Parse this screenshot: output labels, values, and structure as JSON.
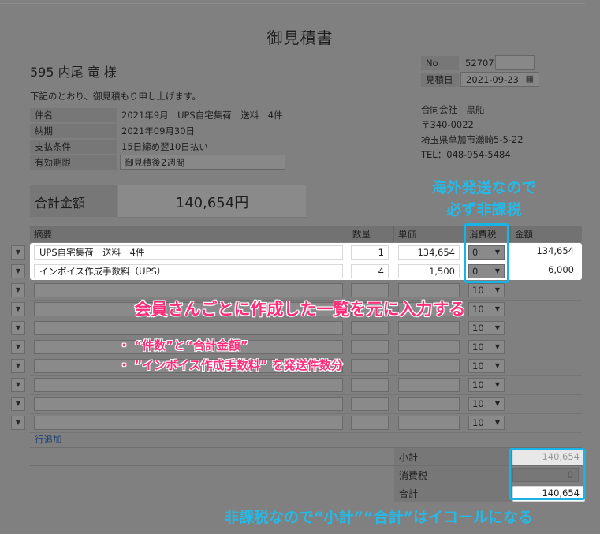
{
  "title": "御見積書",
  "customer": "595 内尾 竜 様",
  "intro": "下記のとおり、御見積もり申し上げます。",
  "info": [
    {
      "label": "件名",
      "value": "2021年9月　UPS自宅集荷　送料　4件"
    },
    {
      "label": "納期",
      "value": "2021年09月30日"
    },
    {
      "label": "支払条件",
      "value": "15日締め翌10日払い"
    },
    {
      "label": "有効期限",
      "value": "御見積後2週間"
    }
  ],
  "meta": {
    "no_label": "No",
    "no_value": "52707",
    "date_label": "見積日",
    "date_value": "2021-09-23"
  },
  "company": {
    "name": "合同会社　黒船",
    "zip": "〒340-0022",
    "address": "埼玉県草加市瀬崎5-5-22",
    "tel": "TEL：048-954-5484"
  },
  "total": {
    "label": "合計金額",
    "value": "140,654円"
  },
  "table": {
    "headers": {
      "item": "摘要",
      "qty": "数量",
      "unit": "単価",
      "tax": "消費税",
      "amount": "金額"
    },
    "rows": [
      {
        "item": "UPS自宅集荷　送料　4件",
        "qty": "1",
        "unit": "134,654",
        "tax": "0",
        "amount": "134,654"
      },
      {
        "item": "インボイス作成手数料（UPS）",
        "qty": "4",
        "unit": "1,500",
        "tax": "0",
        "amount": "6,000"
      },
      {
        "item": "",
        "qty": "",
        "unit": "",
        "tax": "10",
        "amount": ""
      },
      {
        "item": "",
        "qty": "",
        "unit": "",
        "tax": "10",
        "amount": ""
      },
      {
        "item": "",
        "qty": "",
        "unit": "",
        "tax": "10",
        "amount": ""
      },
      {
        "item": "",
        "qty": "",
        "unit": "",
        "tax": "10",
        "amount": ""
      },
      {
        "item": "",
        "qty": "",
        "unit": "",
        "tax": "10",
        "amount": ""
      },
      {
        "item": "",
        "qty": "",
        "unit": "",
        "tax": "10",
        "amount": ""
      },
      {
        "item": "",
        "qty": "",
        "unit": "",
        "tax": "10",
        "amount": ""
      },
      {
        "item": "",
        "qty": "",
        "unit": "",
        "tax": "10",
        "amount": ""
      }
    ],
    "add_row": "行追加"
  },
  "summary": {
    "subtotal_label": "小計",
    "subtotal_value": "140,654",
    "tax_label": "消費税",
    "tax_value": "0",
    "total_label": "合計",
    "total_value": "140,654"
  },
  "annotations": {
    "tax_note_line1": "海外発送なので",
    "tax_note_line2": "必ず非課税",
    "main_note": "会員さんごとに作成した一覧を元に入力する",
    "bullet1": "・ “件数”と“合計金額”",
    "bullet2": "・ ”インボイス作成手数料” を発送件数分",
    "bottom_note": "非課税なので“小計”“合計”はイコールになる"
  },
  "colors": {
    "annotation_cyan": "#19b4e6",
    "annotation_pink": "#ff2d7a",
    "overlay": "#808080"
  }
}
